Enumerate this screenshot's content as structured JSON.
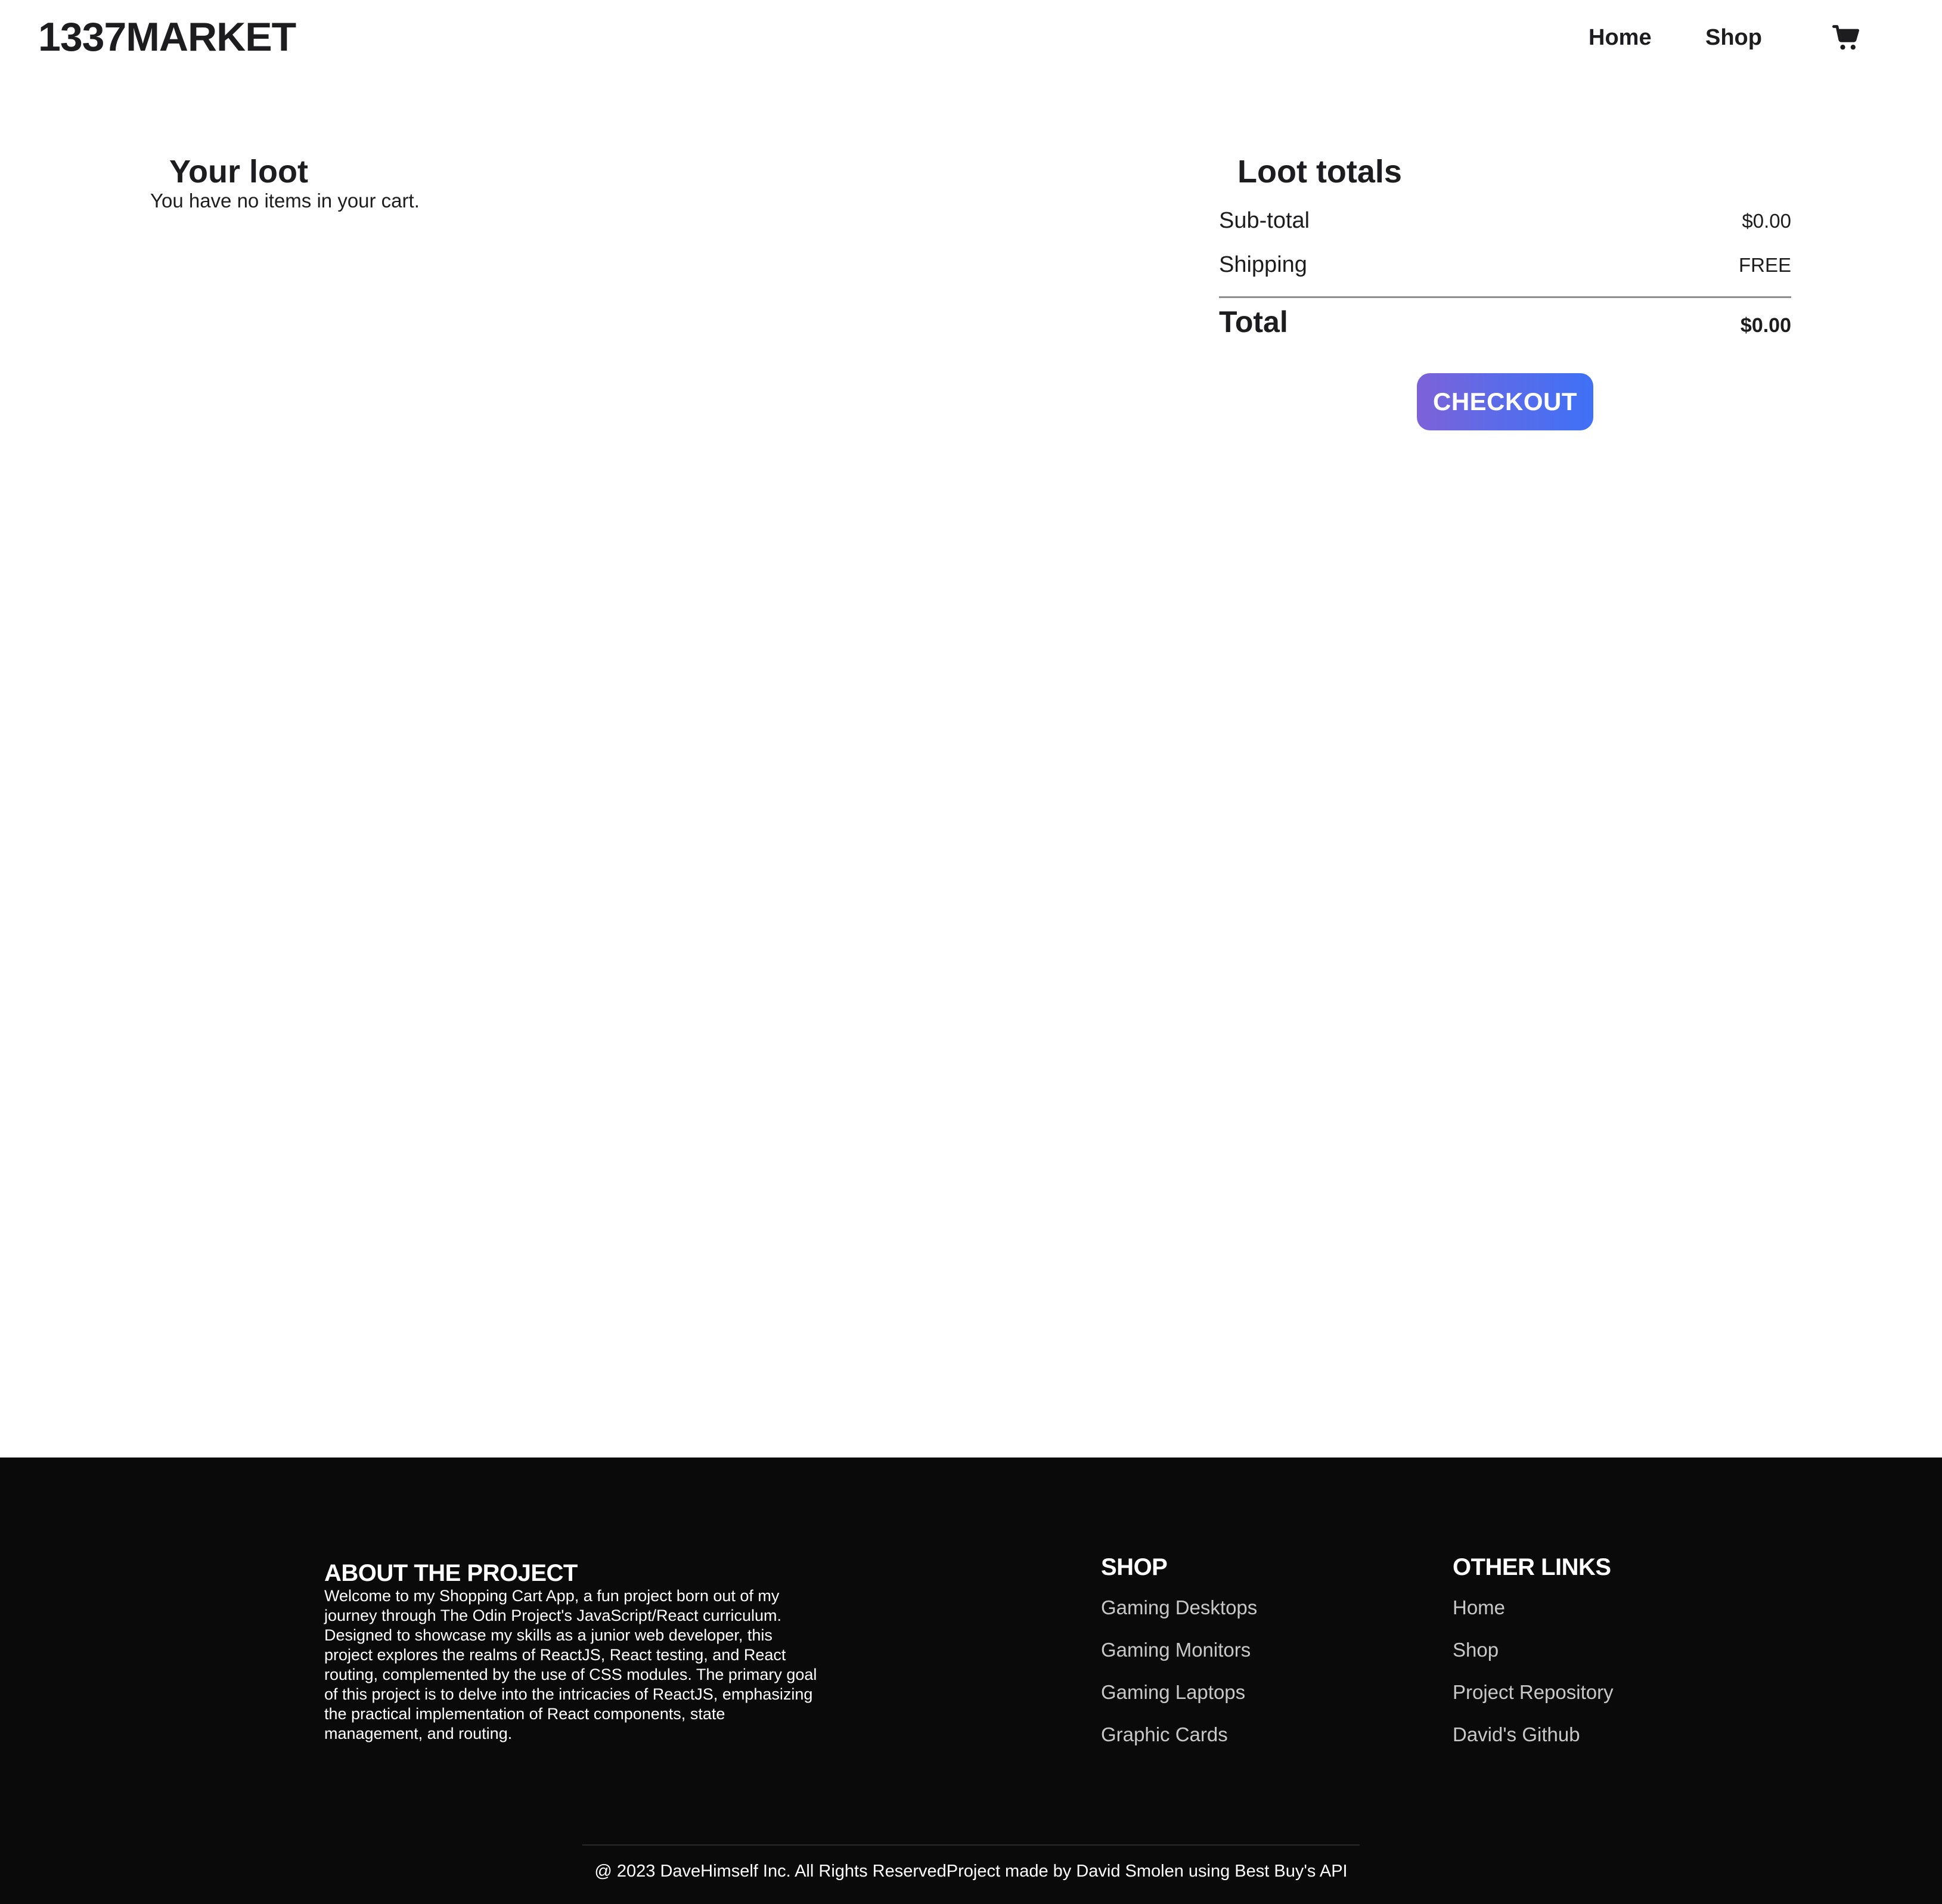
{
  "header": {
    "logo": "1337MARKET",
    "nav": {
      "home": "Home",
      "shop": "Shop"
    },
    "cart_icon": "shopping-cart-icon"
  },
  "cart": {
    "title": "Your loot",
    "empty_message": "You have no items in your cart."
  },
  "totals": {
    "title": "Loot totals",
    "subtotal_label": "Sub-total",
    "subtotal_value": "$0.00",
    "shipping_label": "Shipping",
    "shipping_value": "FREE",
    "total_label": "Total",
    "total_value": "$0.00",
    "checkout_label": "CHECKOUT"
  },
  "footer": {
    "about": {
      "title": "ABOUT THE PROJECT",
      "text": "Welcome to my Shopping Cart App, a fun project born out of my journey through The Odin Project's JavaScript/React curriculum. Designed to showcase my skills as a junior web developer, this project explores the realms of ReactJS, React testing, and React routing, complemented by the use of CSS modules. The primary goal of this project is to delve into the intricacies of ReactJS, emphasizing the practical implementation of React components, state management, and routing."
    },
    "shop": {
      "title": "SHOP",
      "links": [
        "Gaming Desktops",
        "Gaming Monitors",
        "Gaming Laptops",
        "Graphic Cards"
      ]
    },
    "other": {
      "title": "OTHER LINKS",
      "links": [
        "Home",
        "Shop",
        "Project Repository",
        "David's Github"
      ]
    },
    "copyright": "@ 2023 DaveHimself Inc. All Rights ReservedProject made by David Smolen using Best Buy's API"
  },
  "colors": {
    "checkout_gradient_start": "#7d62d8",
    "checkout_gradient_end": "#3f71f6",
    "footer_background": "#0a0a0a",
    "text_dark": "#1d1d1f"
  }
}
